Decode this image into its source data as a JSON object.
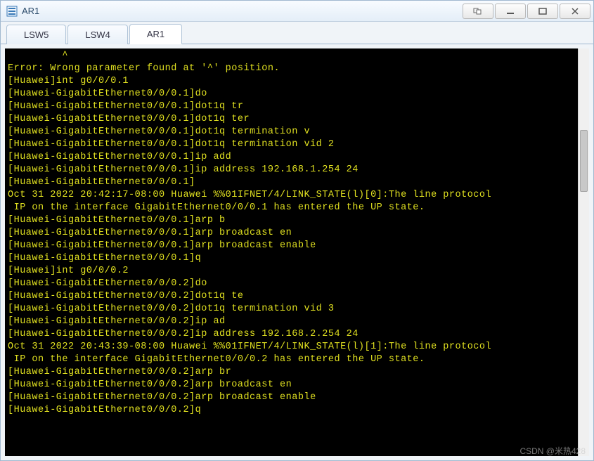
{
  "window": {
    "title": "AR1"
  },
  "tabs": [
    {
      "label": "LSW5",
      "active": false
    },
    {
      "label": "LSW4",
      "active": false
    },
    {
      "label": "AR1",
      "active": true
    }
  ],
  "terminal": {
    "lines": [
      "         ^",
      "Error: Wrong parameter found at '^' position.",
      "[Huawei]int g0/0/0.1",
      "[Huawei-GigabitEthernet0/0/0.1]do",
      "[Huawei-GigabitEthernet0/0/0.1]dot1q tr",
      "[Huawei-GigabitEthernet0/0/0.1]dot1q ter",
      "[Huawei-GigabitEthernet0/0/0.1]dot1q termination v",
      "[Huawei-GigabitEthernet0/0/0.1]dot1q termination vid 2",
      "[Huawei-GigabitEthernet0/0/0.1]ip add",
      "[Huawei-GigabitEthernet0/0/0.1]ip address 192.168.1.254 24",
      "[Huawei-GigabitEthernet0/0/0.1]",
      "Oct 31 2022 20:42:17-08:00 Huawei %%01IFNET/4/LINK_STATE(l)[0]:The line protocol",
      " IP on the interface GigabitEthernet0/0/0.1 has entered the UP state.",
      "[Huawei-GigabitEthernet0/0/0.1]arp b",
      "[Huawei-GigabitEthernet0/0/0.1]arp broadcast en",
      "[Huawei-GigabitEthernet0/0/0.1]arp broadcast enable",
      "[Huawei-GigabitEthernet0/0/0.1]q",
      "[Huawei]int g0/0/0.2",
      "[Huawei-GigabitEthernet0/0/0.2]do",
      "[Huawei-GigabitEthernet0/0/0.2]dot1q te",
      "[Huawei-GigabitEthernet0/0/0.2]dot1q termination vid 3",
      "[Huawei-GigabitEthernet0/0/0.2]ip ad",
      "[Huawei-GigabitEthernet0/0/0.2]ip address 192.168.2.254 24",
      "Oct 31 2022 20:43:39-08:00 Huawei %%01IFNET/4/LINK_STATE(l)[1]:The line protocol",
      " IP on the interface GigabitEthernet0/0/0.2 has entered the UP state.",
      "[Huawei-GigabitEthernet0/0/0.2]arp br",
      "[Huawei-GigabitEthernet0/0/0.2]arp broadcast en",
      "[Huawei-GigabitEthernet0/0/0.2]arp broadcast enable",
      "[Huawei-GigabitEthernet0/0/0.2]q"
    ]
  },
  "watermark": "CSDN @米热428"
}
